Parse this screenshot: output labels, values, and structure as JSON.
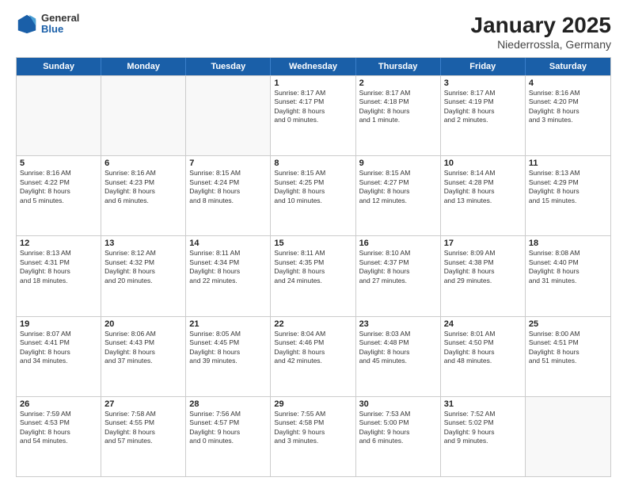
{
  "header": {
    "logo_general": "General",
    "logo_blue": "Blue",
    "month_title": "January 2025",
    "location": "Niederrossla, Germany"
  },
  "days_of_week": [
    "Sunday",
    "Monday",
    "Tuesday",
    "Wednesday",
    "Thursday",
    "Friday",
    "Saturday"
  ],
  "weeks": [
    [
      {
        "day": "",
        "text": ""
      },
      {
        "day": "",
        "text": ""
      },
      {
        "day": "",
        "text": ""
      },
      {
        "day": "1",
        "text": "Sunrise: 8:17 AM\nSunset: 4:17 PM\nDaylight: 8 hours\nand 0 minutes."
      },
      {
        "day": "2",
        "text": "Sunrise: 8:17 AM\nSunset: 4:18 PM\nDaylight: 8 hours\nand 1 minute."
      },
      {
        "day": "3",
        "text": "Sunrise: 8:17 AM\nSunset: 4:19 PM\nDaylight: 8 hours\nand 2 minutes."
      },
      {
        "day": "4",
        "text": "Sunrise: 8:16 AM\nSunset: 4:20 PM\nDaylight: 8 hours\nand 3 minutes."
      }
    ],
    [
      {
        "day": "5",
        "text": "Sunrise: 8:16 AM\nSunset: 4:22 PM\nDaylight: 8 hours\nand 5 minutes."
      },
      {
        "day": "6",
        "text": "Sunrise: 8:16 AM\nSunset: 4:23 PM\nDaylight: 8 hours\nand 6 minutes."
      },
      {
        "day": "7",
        "text": "Sunrise: 8:15 AM\nSunset: 4:24 PM\nDaylight: 8 hours\nand 8 minutes."
      },
      {
        "day": "8",
        "text": "Sunrise: 8:15 AM\nSunset: 4:25 PM\nDaylight: 8 hours\nand 10 minutes."
      },
      {
        "day": "9",
        "text": "Sunrise: 8:15 AM\nSunset: 4:27 PM\nDaylight: 8 hours\nand 12 minutes."
      },
      {
        "day": "10",
        "text": "Sunrise: 8:14 AM\nSunset: 4:28 PM\nDaylight: 8 hours\nand 13 minutes."
      },
      {
        "day": "11",
        "text": "Sunrise: 8:13 AM\nSunset: 4:29 PM\nDaylight: 8 hours\nand 15 minutes."
      }
    ],
    [
      {
        "day": "12",
        "text": "Sunrise: 8:13 AM\nSunset: 4:31 PM\nDaylight: 8 hours\nand 18 minutes."
      },
      {
        "day": "13",
        "text": "Sunrise: 8:12 AM\nSunset: 4:32 PM\nDaylight: 8 hours\nand 20 minutes."
      },
      {
        "day": "14",
        "text": "Sunrise: 8:11 AM\nSunset: 4:34 PM\nDaylight: 8 hours\nand 22 minutes."
      },
      {
        "day": "15",
        "text": "Sunrise: 8:11 AM\nSunset: 4:35 PM\nDaylight: 8 hours\nand 24 minutes."
      },
      {
        "day": "16",
        "text": "Sunrise: 8:10 AM\nSunset: 4:37 PM\nDaylight: 8 hours\nand 27 minutes."
      },
      {
        "day": "17",
        "text": "Sunrise: 8:09 AM\nSunset: 4:38 PM\nDaylight: 8 hours\nand 29 minutes."
      },
      {
        "day": "18",
        "text": "Sunrise: 8:08 AM\nSunset: 4:40 PM\nDaylight: 8 hours\nand 31 minutes."
      }
    ],
    [
      {
        "day": "19",
        "text": "Sunrise: 8:07 AM\nSunset: 4:41 PM\nDaylight: 8 hours\nand 34 minutes."
      },
      {
        "day": "20",
        "text": "Sunrise: 8:06 AM\nSunset: 4:43 PM\nDaylight: 8 hours\nand 37 minutes."
      },
      {
        "day": "21",
        "text": "Sunrise: 8:05 AM\nSunset: 4:45 PM\nDaylight: 8 hours\nand 39 minutes."
      },
      {
        "day": "22",
        "text": "Sunrise: 8:04 AM\nSunset: 4:46 PM\nDaylight: 8 hours\nand 42 minutes."
      },
      {
        "day": "23",
        "text": "Sunrise: 8:03 AM\nSunset: 4:48 PM\nDaylight: 8 hours\nand 45 minutes."
      },
      {
        "day": "24",
        "text": "Sunrise: 8:01 AM\nSunset: 4:50 PM\nDaylight: 8 hours\nand 48 minutes."
      },
      {
        "day": "25",
        "text": "Sunrise: 8:00 AM\nSunset: 4:51 PM\nDaylight: 8 hours\nand 51 minutes."
      }
    ],
    [
      {
        "day": "26",
        "text": "Sunrise: 7:59 AM\nSunset: 4:53 PM\nDaylight: 8 hours\nand 54 minutes."
      },
      {
        "day": "27",
        "text": "Sunrise: 7:58 AM\nSunset: 4:55 PM\nDaylight: 8 hours\nand 57 minutes."
      },
      {
        "day": "28",
        "text": "Sunrise: 7:56 AM\nSunset: 4:57 PM\nDaylight: 9 hours\nand 0 minutes."
      },
      {
        "day": "29",
        "text": "Sunrise: 7:55 AM\nSunset: 4:58 PM\nDaylight: 9 hours\nand 3 minutes."
      },
      {
        "day": "30",
        "text": "Sunrise: 7:53 AM\nSunset: 5:00 PM\nDaylight: 9 hours\nand 6 minutes."
      },
      {
        "day": "31",
        "text": "Sunrise: 7:52 AM\nSunset: 5:02 PM\nDaylight: 9 hours\nand 9 minutes."
      },
      {
        "day": "",
        "text": ""
      }
    ]
  ]
}
